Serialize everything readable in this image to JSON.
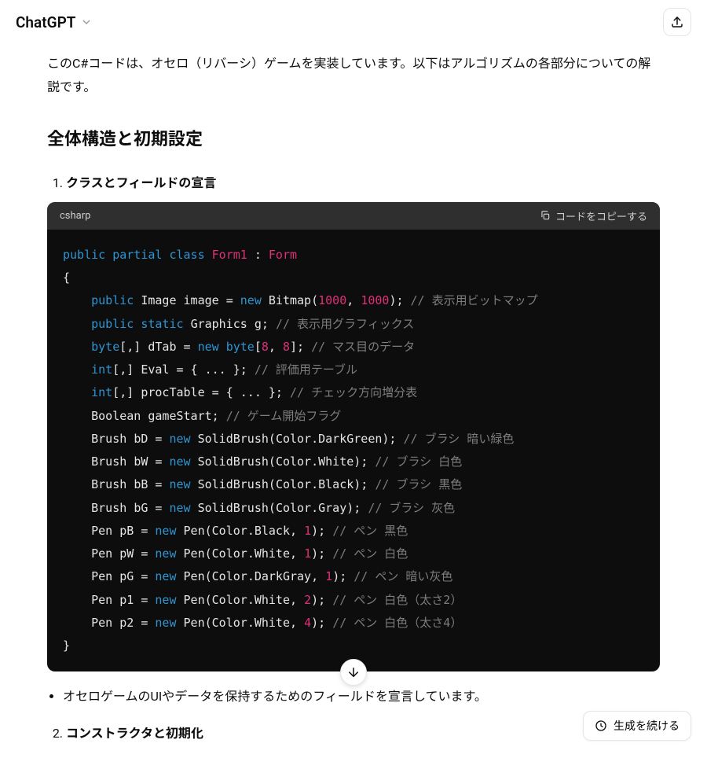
{
  "header": {
    "title": "ChatGPT"
  },
  "intro": "このC#コードは、オセロ（リバーシ）ゲームを実装しています。以下はアルゴリズムの各部分についての解説です。",
  "section_heading": "全体構造と初期設定",
  "list": {
    "item1_title": "クラスとフィールドの宣言",
    "item2_title": "コンストラクタと初期化"
  },
  "code": {
    "lang": "csharp",
    "copy_label": "コードをコピーする",
    "tokens": {
      "public": "public",
      "partial": "partial",
      "class_kw": "class",
      "new": "new",
      "static": "static",
      "Form1": "Form1",
      "Form": "Form",
      "Image": "Image",
      "image": "image",
      "Bitmap": "Bitmap",
      "n1000a": "1000",
      "n1000b": "1000",
      "cm_bitmap": "// 表示用ビットマップ",
      "Graphics": "Graphics",
      "g": "g",
      "cm_graphics": "// 表示用グラフィックス",
      "byte": "byte",
      "dTab": "dTab",
      "n8a": "8",
      "n8b": "8",
      "cm_dtab": "// マス目のデータ",
      "int": "int",
      "Eval": "Eval",
      "cm_eval": "// 評価用テーブル",
      "procTable": "procTable",
      "cm_proc": "// チェック方向増分表",
      "Boolean": "Boolean",
      "gameStart": "gameStart",
      "cm_start": "// ゲーム開始フラグ",
      "Brush": "Brush",
      "SolidBrush": "SolidBrush",
      "Color": "Color",
      "bD": "bD",
      "DarkGreen": "DarkGreen",
      "cm_bD": "// ブラシ 暗い緑色",
      "bW": "bW",
      "White": "White",
      "cm_bW": "// ブラシ 白色",
      "bB": "bB",
      "Black": "Black",
      "cm_bB": "// ブラシ 黒色",
      "bG": "bG",
      "Gray": "Gray",
      "cm_bG": "// ブラシ 灰色",
      "Pen": "Pen",
      "pB": "pB",
      "n1a": "1",
      "cm_pB": "// ペン 黒色",
      "pW": "pW",
      "n1b": "1",
      "cm_pW": "// ペン 白色",
      "pG": "pG",
      "DarkGray": "DarkGray",
      "n1c": "1",
      "cm_pG": "// ペン 暗い灰色",
      "p1": "p1",
      "n2": "2",
      "cm_p1": "// ペン 白色（太さ2）",
      "p2": "p2",
      "n4": "4",
      "cm_p2": "// ペン 白色（太さ4）"
    }
  },
  "bullet1": "オセロゲームのUIやデータを保持するためのフィールドを宣言しています。",
  "continue_label": "生成を続ける"
}
